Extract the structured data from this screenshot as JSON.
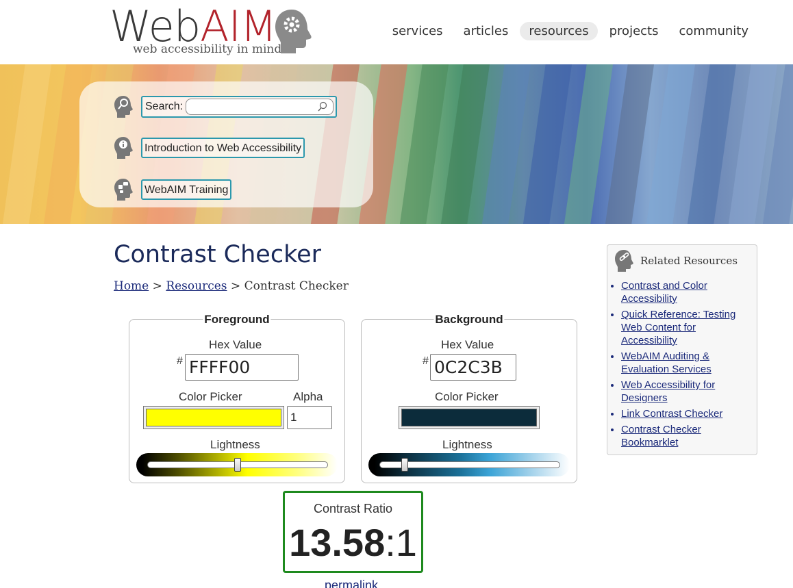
{
  "brand": {
    "name_part1": "Web",
    "name_part2": "AIM",
    "tagline": "web accessibility in mind"
  },
  "nav": {
    "items": [
      {
        "label": "services",
        "active": false
      },
      {
        "label": "articles",
        "active": false
      },
      {
        "label": "resources",
        "active": true
      },
      {
        "label": "projects",
        "active": false
      },
      {
        "label": "community",
        "active": false
      }
    ]
  },
  "banner": {
    "search_label": "Search:",
    "search_value": "",
    "intro_link": "Introduction to Web Accessibility",
    "training_link": "WebAIM Training"
  },
  "page": {
    "title": "Contrast Checker",
    "breadcrumb": {
      "home": "Home",
      "sep1": " > ",
      "resources": "Resources",
      "sep2": " > ",
      "current": "Contrast Checker"
    }
  },
  "foreground": {
    "legend": "Foreground",
    "hex_label": "Hex Value",
    "hash": "#",
    "hex_value": "FFFF00",
    "picker_label": "Color Picker",
    "color": "#FFFF00",
    "alpha_label": "Alpha",
    "alpha_value": "1",
    "lightness_label": "Lightness",
    "lightness": 0.5
  },
  "background": {
    "legend": "Background",
    "hex_label": "Hex Value",
    "hash": "#",
    "hex_value": "0C2C3B",
    "picker_label": "Color Picker",
    "color": "#0C2C3B",
    "lightness_label": "Lightness",
    "lightness": 0.14
  },
  "result": {
    "label": "Contrast Ratio",
    "ratio_main": "13.58",
    "ratio_suffix": ":1",
    "permalink": "permalink",
    "pass_color": "#1e8a1e"
  },
  "sidebar": {
    "title": "Related Resources",
    "links": [
      "Contrast and Color Accessibility",
      "Quick Reference: Testing Web Content for Accessibility",
      "WebAIM Auditing & Evaluation Services",
      "Web Accessibility for Designers",
      "Link Contrast Checker",
      "Contrast Checker Bookmarklet"
    ]
  }
}
